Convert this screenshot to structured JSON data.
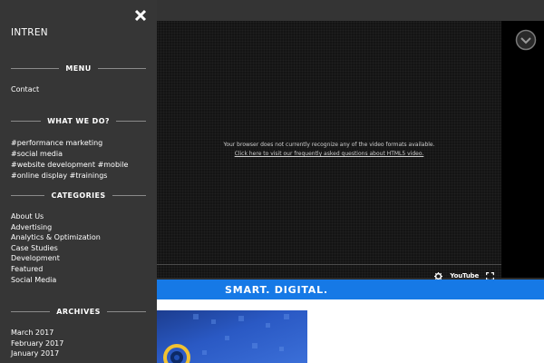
{
  "brand": {
    "logo_text": "INTREN"
  },
  "menu": {
    "title": "MENU",
    "items": [
      "Contact"
    ]
  },
  "what_we_do": {
    "title": "WHAT WE DO?",
    "tags": [
      "#performance marketing",
      "#social media",
      "#website development",
      "#mobile",
      "#online display",
      "#trainings"
    ]
  },
  "categories": {
    "title": "CATEGORIES",
    "items": [
      "About Us",
      "Advertising",
      "Analytics & Optimization",
      "Case Studies",
      "Development",
      "Featured",
      "Social Media"
    ]
  },
  "archives": {
    "title": "ARCHIVES",
    "items": [
      "March 2017",
      "February 2017",
      "January 2017"
    ]
  },
  "video": {
    "message": "Your browser does not currently recognize any of the video formats available.",
    "link_text": "Click here to visit our frequently asked questions about HTML5 video.",
    "youtube_label": "YouTube"
  },
  "banner": {
    "text": "SMART. DIGITAL."
  },
  "colors": {
    "accent": "#1679e6",
    "sidebar_bg": "#363636",
    "video_bg": "#141414"
  }
}
